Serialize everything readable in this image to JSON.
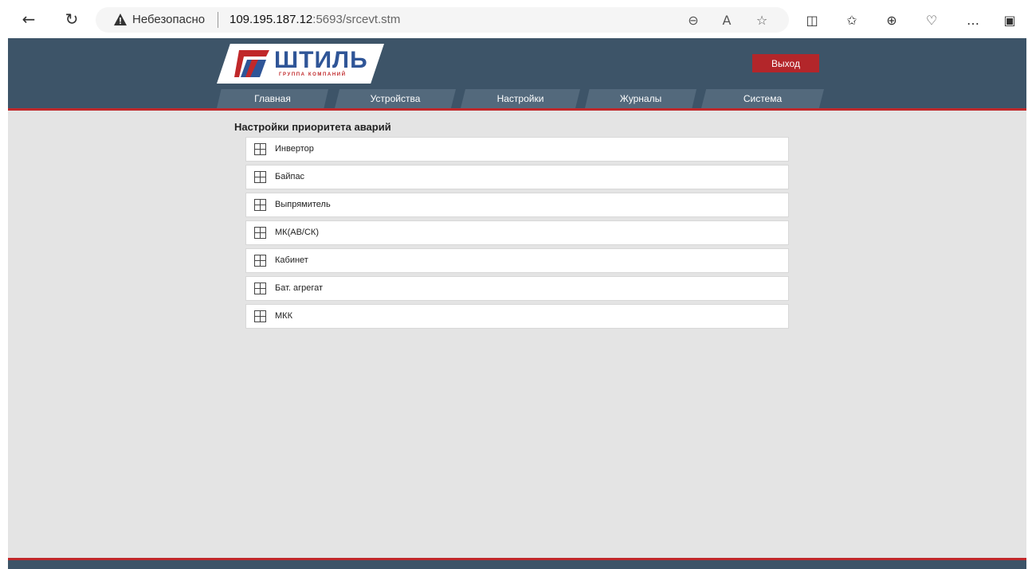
{
  "browser": {
    "insecure_label": "Небезопасно",
    "url_host": "109.195.187.12",
    "url_rest": ":5693/srcevt.stm"
  },
  "header": {
    "logo_text": "ШТИЛЬ",
    "logo_subtitle": "ГРУППА КОМПАНИЙ",
    "exit_label": "Выход",
    "menu": [
      {
        "label": "Главная"
      },
      {
        "label": "Устройства"
      },
      {
        "label": "Настройки"
      },
      {
        "label": "Журналы"
      },
      {
        "label": "Система"
      }
    ]
  },
  "main": {
    "title": "Настройки приоритета аварий",
    "items": [
      {
        "label": "Инвертор",
        "icon": "expand-grid-icon"
      },
      {
        "label": "Байпас",
        "icon": "expand-grid-icon"
      },
      {
        "label": "Выпрямитель",
        "icon": "expand-grid-icon"
      },
      {
        "label": "МК(АВ/СК)",
        "icon": "expand-grid-icon"
      },
      {
        "label": "Кабинет",
        "icon": "expand-grid-icon"
      },
      {
        "label": "Бат. агрегат",
        "icon": "expand-grid-icon"
      },
      {
        "label": "МКК",
        "icon": "expand-grid-icon"
      }
    ]
  },
  "colors": {
    "header_bg": "#3d5468",
    "accent_red": "#c0282a",
    "tab_bg": "#53697c",
    "page_bg": "#e4e4e4"
  }
}
